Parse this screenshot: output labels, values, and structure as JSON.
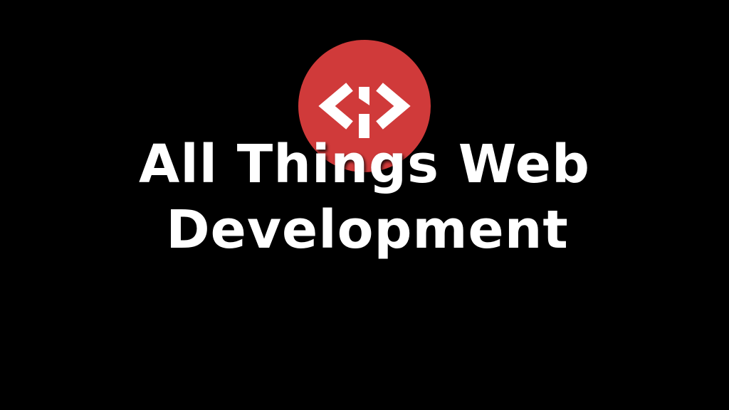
{
  "logo": {
    "icon": "code-brackets-icon",
    "circle_color": "#d03a3a",
    "glyph_color": "#ffffff"
  },
  "title": {
    "line1": "All Things Web",
    "line2": "Development"
  },
  "background_color": "#000000"
}
